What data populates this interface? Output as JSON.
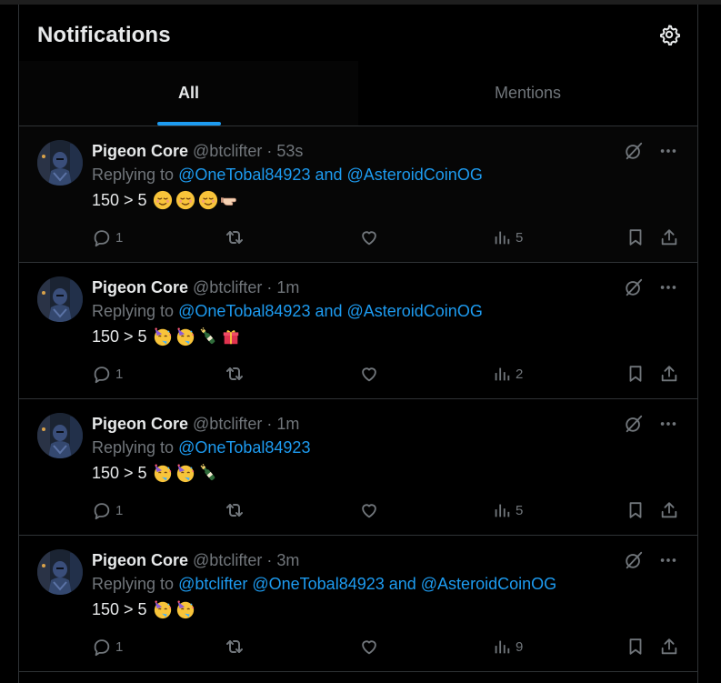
{
  "header": {
    "title": "Notifications",
    "settings_icon": "gear-icon"
  },
  "tabs": [
    {
      "label": "All",
      "active": true
    },
    {
      "label": "Mentions",
      "active": false
    }
  ],
  "colors": {
    "accent": "#1d9bf0",
    "muted": "#71767b",
    "text": "#e7e9ea",
    "border": "#2f3336"
  },
  "tweets": [
    {
      "name": "Pigeon Core",
      "handle": "@btclifter",
      "sep": "·",
      "time": "53s",
      "replying_prefix": "Replying to",
      "replying_to": "@OneTobal84923 and @AsteroidCoinOG",
      "text": "150 > 5",
      "emojis": [
        "relieved-face",
        "relieved-face",
        "relieved-face",
        "pointing-hand"
      ],
      "replies": "1",
      "retweets": "",
      "likes": "",
      "views": "5"
    },
    {
      "name": "Pigeon Core",
      "handle": "@btclifter",
      "sep": "·",
      "time": "1m",
      "replying_prefix": "Replying to",
      "replying_to": "@OneTobal84923 and @AsteroidCoinOG",
      "text": "150 > 5",
      "emojis": [
        "partying-face",
        "partying-face",
        "champagne-bottle",
        "wrapped-gift"
      ],
      "replies": "1",
      "retweets": "",
      "likes": "",
      "views": "2"
    },
    {
      "name": "Pigeon Core",
      "handle": "@btclifter",
      "sep": "·",
      "time": "1m",
      "replying_prefix": "Replying to",
      "replying_to": "@OneTobal84923",
      "text": "150 > 5",
      "emojis": [
        "partying-face",
        "partying-face",
        "champagne-bottle"
      ],
      "replies": "1",
      "retweets": "",
      "likes": "",
      "views": "5"
    },
    {
      "name": "Pigeon Core",
      "handle": "@btclifter",
      "sep": "·",
      "time": "3m",
      "replying_prefix": "Replying to",
      "replying_to": "@btclifter @OneTobal84923 and @AsteroidCoinOG",
      "text": "150 > 5",
      "emojis": [
        "partying-face",
        "partying-face"
      ],
      "replies": "1",
      "retweets": "",
      "likes": "",
      "views": "9"
    }
  ]
}
